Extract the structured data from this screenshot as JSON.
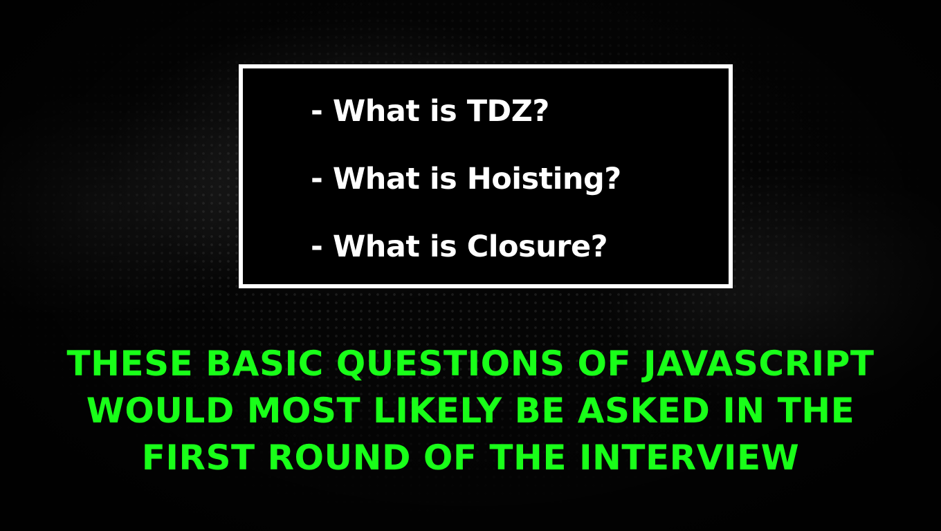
{
  "questions": {
    "items": [
      {
        "label": "- What is TDZ?"
      },
      {
        "label": "- What is Hoisting?"
      },
      {
        "label": "- What is Closure?"
      }
    ]
  },
  "caption": {
    "lines": [
      "THESE BASIC QUESTIONS OF JAVASCRIPT",
      "WOULD MOST LIKELY BE ASKED IN THE",
      "FIRST ROUND OF THE INTERVIEW"
    ]
  },
  "colors": {
    "background": "#000000",
    "box_border": "#ffffff",
    "question_text": "#ffffff",
    "caption_text": "#19ff19"
  }
}
